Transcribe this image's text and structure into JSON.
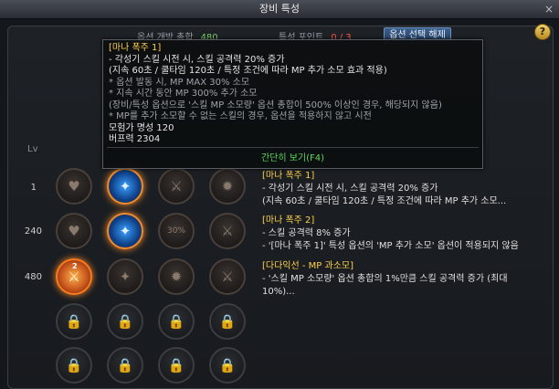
{
  "window": {
    "title": "장비 특성",
    "close_glyph": "×"
  },
  "header": {
    "lock_label": "옵션 개방 총합",
    "lock_value": "480",
    "points_label": "특성 포인트",
    "points_value": "0 / 3",
    "change_button": "옵션 선택 해제"
  },
  "help_glyph": "?",
  "lv_header": "Lv",
  "tooltip": {
    "lines": [
      {
        "text": "[마나 폭주 1]",
        "style": "yel"
      },
      {
        "text": "- 각성기 스킬 시전 시, 스킬 공격력 20% 증가",
        "style": "white"
      },
      {
        "text": "(지속 60초 / 쿨타임 120초 / 특정 조건에 따라 MP 추가 소모 효과 적용)",
        "style": "white"
      },
      {
        "text": "* 옵션 발동 시, MP MAX 30% 소모",
        "style": "gray"
      },
      {
        "text": "* 지속 시간 동안 MP 300% 추가 소모",
        "style": "gray"
      },
      {
        "text": "  (장비/특성 옵션으로 '스킬 MP 소모량' 옵션 총합이 500% 이상인 경우, 해당되지 않음)",
        "style": "gray"
      },
      {
        "text": "* MP를 추가 소모할 수 없는 스킬의 경우, 옵션을 적용하지 않고 시전",
        "style": "gray"
      },
      {
        "text": "모험가 명성 120",
        "style": "white"
      },
      {
        "text": "버프력 2304",
        "style": "white"
      }
    ],
    "footer": "간단히 보기(F4)"
  },
  "rows": [
    {
      "level": "1",
      "title": "[마나 폭주 1]",
      "desc": [
        "- 각성기 스킬 시전 시, 스킬 공격력 20% 증가",
        "(지속 60초 / 쿨타임 120초 / 특정 조건에 따라 MP 추가 소모..."
      ]
    },
    {
      "level": "240",
      "title": "[마나 폭주 2]",
      "desc": [
        "- 스킬 공격력 8% 증가",
        "- '[마나 폭주 1]' 특성 옵션의 'MP 추가 소모' 옵션이 적용되지 않음"
      ]
    },
    {
      "level": "480",
      "title": "[다다익선 - MP 과소모]",
      "desc": [
        "- '스킬 MP 소모량' 옵션 총합의 1%만큼 스킬 공격력 증가 (최대",
        "10%)..."
      ]
    }
  ],
  "slot_badges": {
    "percent": "30%",
    "level_two": "2"
  },
  "icons": {
    "heart_icon": "♥",
    "rune_icon": "✦",
    "gear_icon": "✹",
    "sword_icon": "⚔",
    "lock_icon": "🔒"
  }
}
